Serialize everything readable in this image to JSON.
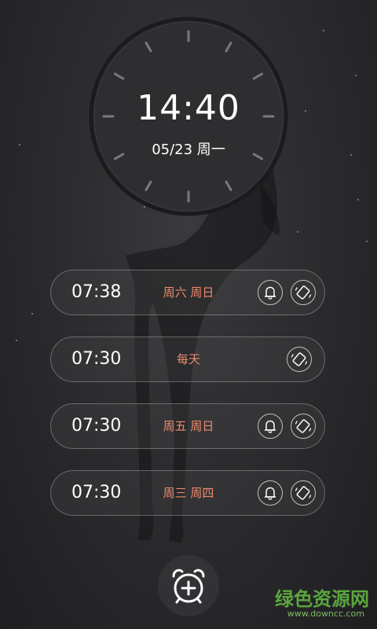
{
  "clock": {
    "time": "14:40",
    "date": "05/23 周一"
  },
  "alarms": [
    {
      "time": "07:38",
      "days": "周六 周日",
      "has_bell": true,
      "has_vibrate": true
    },
    {
      "time": "07:30",
      "days": "每天",
      "has_bell": false,
      "has_vibrate": true
    },
    {
      "time": "07:30",
      "days": "周五 周日",
      "has_bell": true,
      "has_vibrate": true
    },
    {
      "time": "07:30",
      "days": "周三 周四",
      "has_bell": true,
      "has_vibrate": true
    }
  ],
  "icons": {
    "bell": "bell-icon",
    "vibrate": "vibrate-icon",
    "add_alarm": "alarm-clock-add-icon"
  },
  "watermark": {
    "title": "绿色资源网",
    "url": "www.downcc.com"
  },
  "colors": {
    "accent_days": "#f08a6c",
    "watermark_green": "#5aa63e",
    "background": "#2c2c2f"
  }
}
